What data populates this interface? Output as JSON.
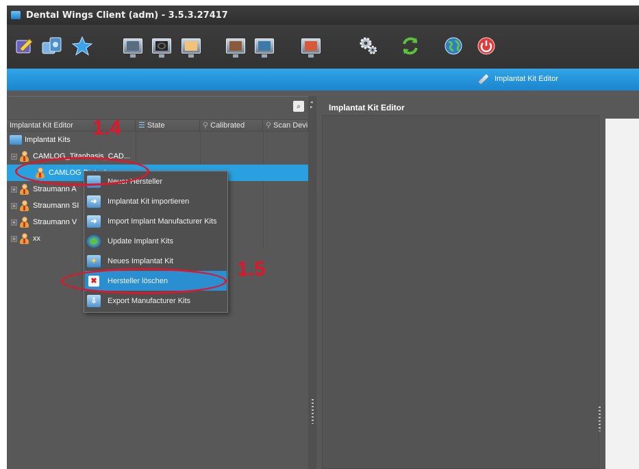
{
  "window": {
    "title": "Dental Wings Client (adm) - 3.5.3.27417"
  },
  "toolbar": {
    "icons": [
      "edit-order-icon",
      "scan-icon",
      "favorites-star-icon",
      "monitor-view-1-icon",
      "monitor-view-2-icon",
      "monitor-view-3-icon",
      "monitor-view-4-icon",
      "monitor-view-5-icon",
      "monitor-view-6-icon",
      "settings-gears-icon",
      "sync-arrows-icon",
      "globe-icon",
      "power-icon"
    ]
  },
  "header": {
    "active_tab": "Implantat Kit Editor"
  },
  "left_panel": {
    "columns": [
      "Implantat Kit Editor",
      "State",
      "Calibrated",
      "Scan Devi"
    ],
    "tree": {
      "root": "Implantat Kits",
      "rows": [
        {
          "label": "CAMLOG_Titanbasis_CAD...",
          "expander": "−"
        },
        {
          "label": "CAMLOG Biotech",
          "selected": true
        },
        {
          "label": "Straumann A",
          "expander": "+"
        },
        {
          "label": "Straumann SI",
          "expander": "+"
        },
        {
          "label": "Straumann V",
          "expander": "+"
        },
        {
          "label": "xx",
          "expander": "+"
        }
      ]
    }
  },
  "right_panel": {
    "title": "Implantat Kit Editor"
  },
  "context_menu": {
    "items": [
      {
        "label": "Neuer Hersteller",
        "icon": "new-manufacturer-icon"
      },
      {
        "label": "Implantat Kit importieren",
        "icon": "import-kit-icon"
      },
      {
        "label": "Import Implant Manufacturer Kits",
        "icon": "import-manufacturer-kits-icon"
      },
      {
        "label": "Update Implant Kits",
        "icon": "update-globe-icon"
      },
      {
        "label": "Neues Implantat Kit",
        "icon": "new-kit-icon"
      },
      {
        "label": "Hersteller löschen",
        "icon": "delete-x-icon",
        "highlighted": true
      },
      {
        "label": "Export Manufacturer Kits",
        "icon": "export-kits-icon"
      }
    ]
  },
  "annotations": {
    "step_1_4": "1.4",
    "step_1_5": "1.5"
  },
  "colors": {
    "accent_blue": "#29a0df",
    "annotation_red": "#e0172a",
    "panel_gray": "#585858"
  }
}
